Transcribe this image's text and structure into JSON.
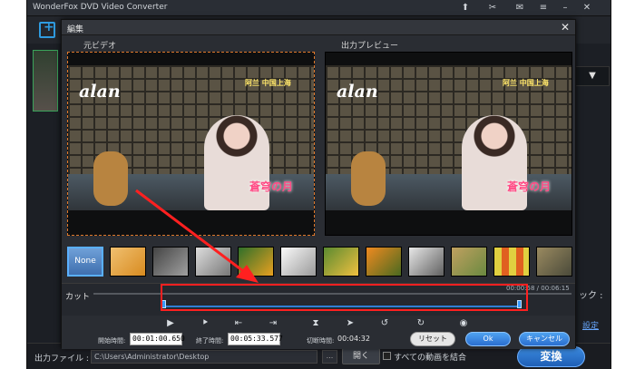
{
  "app": {
    "title": "WonderFox DVD Video Converter",
    "side_label": "ック :",
    "side_link": "設定",
    "dropdown_glyph": "▼",
    "output_label": "出力ファイル :",
    "output_path": "C:\\Users\\Administrator\\Desktop",
    "browse_label": "...",
    "open_label": "開く",
    "merge_label": "すべての動画を結合",
    "convert_label": "変換"
  },
  "dialog": {
    "title": "編集",
    "close_glyph": "✕",
    "original_label": "元ビデオ",
    "preview_label": "出力プレビュー",
    "video_overlay": {
      "logo": "alan",
      "caption": "阿兰 中国上海",
      "song_title": "蒼穹の月"
    },
    "filters": {
      "none_label": "None",
      "count": 12
    },
    "cut": {
      "label": "カット",
      "time_readout": "00:00:58 / 00:06:15"
    },
    "footer": {
      "start_label": "開始時間:",
      "start_value": "00:01:00.650",
      "end_label": "終了時間:",
      "end_value": "00:05:33.577",
      "duration_label": "切断時間:",
      "duration_value": "00:04:32",
      "reset_label": "リセット",
      "ok_label": "Ok",
      "cancel_label": "キャンセル"
    }
  },
  "colors": {
    "accent_blue": "#2f7fd4",
    "annotation_red": "#ff2020",
    "dialog_bg": "#2a2d33",
    "crop_border": "#e0782a"
  }
}
